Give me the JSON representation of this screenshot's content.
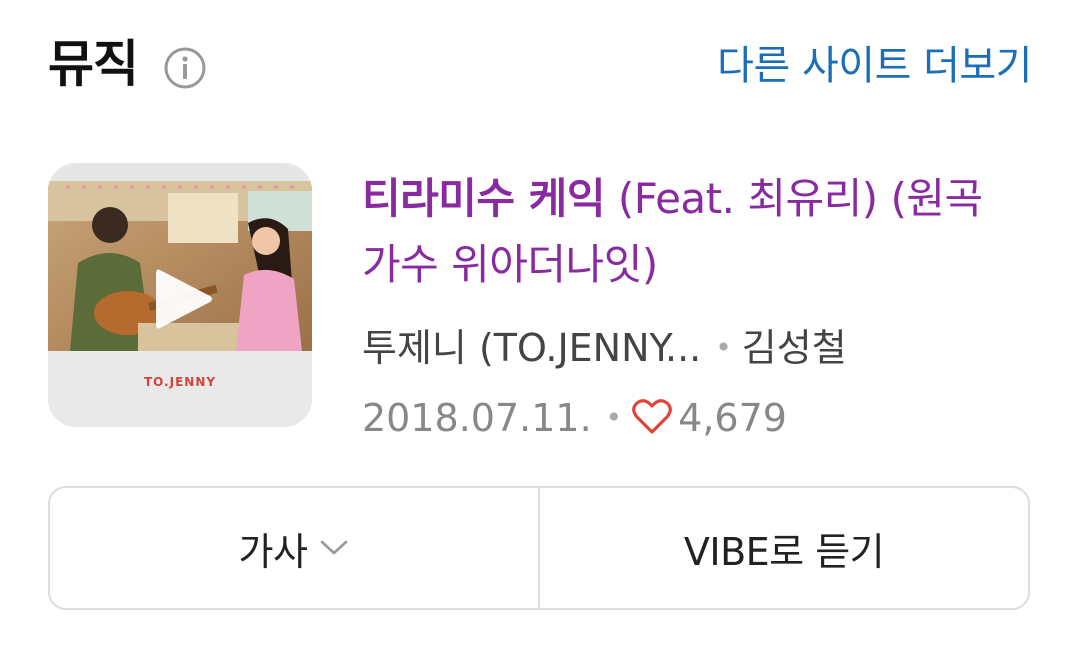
{
  "header": {
    "title": "뮤직",
    "more_link": "다른 사이트 더보기"
  },
  "song": {
    "title_main": "티라미수 케익",
    "title_sub": " (Feat. 최유리) (원곡가수 위아더나잇)",
    "artist": "투제니 (TO.JENNY...",
    "composer": "김성철",
    "date": "2018.07.11.",
    "likes": "4,679",
    "album_caption": "TO.JENNY"
  },
  "buttons": {
    "lyrics_label": "가사",
    "vibe_label": "VIBE로 듣기"
  },
  "colors": {
    "title": "#8a2aa0",
    "link": "#1a6fb8",
    "heart": "#e0453c"
  },
  "icons": [
    "info-icon",
    "play-icon",
    "heart-icon",
    "chevron-down-icon"
  ]
}
